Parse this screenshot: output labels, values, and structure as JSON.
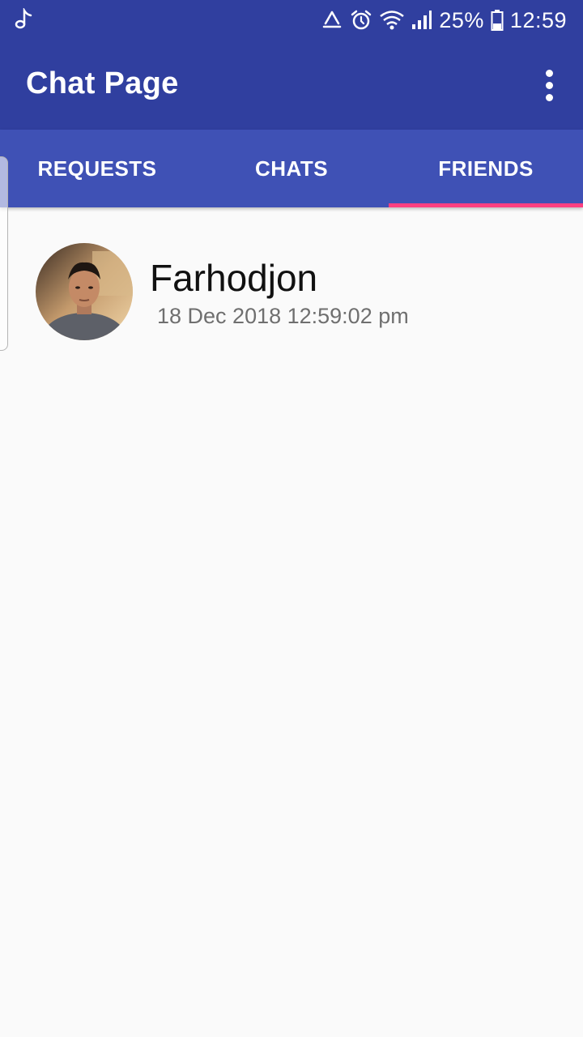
{
  "status_bar": {
    "icons": [
      "music-note-icon",
      "recycle-icon",
      "alarm-icon",
      "wifi-icon",
      "signal-icon"
    ],
    "battery": "25%",
    "time": "12:59"
  },
  "app_bar": {
    "title": "Chat Page",
    "menu_icon": "more-vert-icon"
  },
  "tabs": [
    {
      "label": "REQUESTS",
      "selected": false
    },
    {
      "label": "CHATS",
      "selected": false
    },
    {
      "label": "FRIENDS",
      "selected": true
    }
  ],
  "colors": {
    "primary_dark": "#303f9f",
    "primary": "#3f51b5",
    "accent": "#ff4081",
    "background": "#fafafa"
  },
  "friends": [
    {
      "name": "Farhodjon",
      "date": "18 Dec 2018 12:59:02 pm",
      "avatar": "avatar-photo"
    }
  ]
}
